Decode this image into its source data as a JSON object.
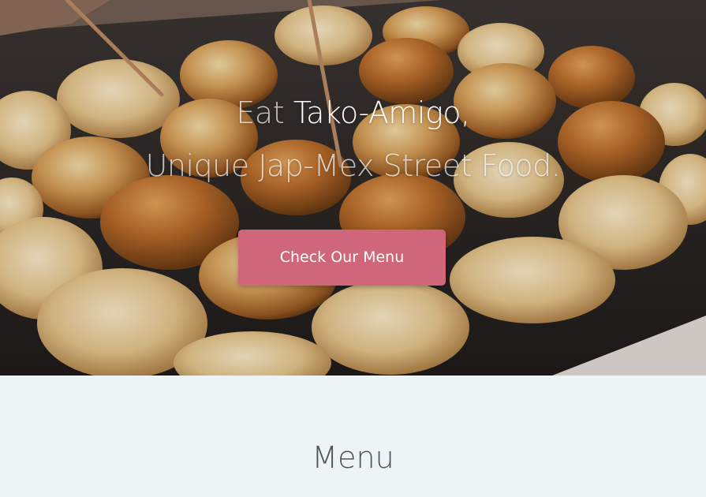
{
  "hero": {
    "line1_prefix": "Eat ",
    "line1_brand": "Tako-Amigo,",
    "line2": "Unique Jap-Mex Street Food.",
    "cta_label": "Check Our Menu"
  },
  "menu_section": {
    "title": "Menu"
  },
  "colors": {
    "cta_background": "#cf6679",
    "section_background": "#eef3f5",
    "title_text": "#4e5457"
  }
}
